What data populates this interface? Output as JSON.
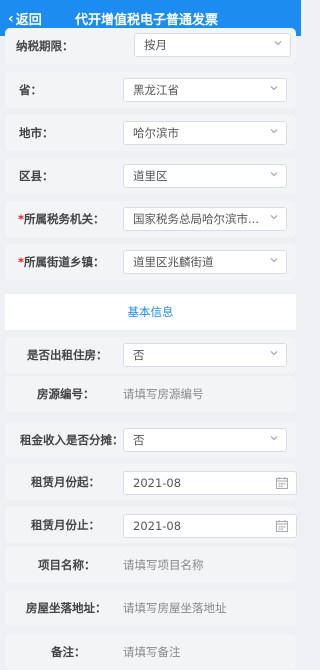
{
  "header": {
    "back_label": "返回",
    "title": "代开增值税电子普通发票"
  },
  "tax_info": {
    "period_label": "纳税期限：",
    "period_value": "按月",
    "province_label": "省：",
    "province_value": "黑龙江省",
    "city_label": "地市：",
    "city_value": "哈尔滨市",
    "district_label": "区县：",
    "district_value": "道里区",
    "tax_office_label": "所属税务机关：",
    "tax_office_value": "国家税务总局哈尔滨市...",
    "street_label": "所属街道乡镇：",
    "street_value": "道里区兆麟街道",
    "required_mark": "*"
  },
  "basic_info": {
    "section_title": "基本信息",
    "rental_label": "是否出租住房：",
    "rental_value": "否",
    "house_no_label": "房源编号：",
    "house_no_placeholder": "请填写房源编号",
    "split_label": "租金收入是否分摊：",
    "split_value": "否",
    "start_label": "租赁月份起：",
    "start_value": "2021-08",
    "end_label": "租赁月份止：",
    "end_value": "2021-08",
    "project_label": "项目名称：",
    "project_placeholder": "请填写项目名称",
    "address_label": "房屋坐落地址：",
    "address_placeholder": "请填写房屋坐落地址",
    "remark_label": "备注：",
    "remark_placeholder": "请填写备注"
  },
  "colors": {
    "header_bg": "#1d8cf0",
    "required": "#e0201f",
    "section_title": "#1d8cf0"
  }
}
